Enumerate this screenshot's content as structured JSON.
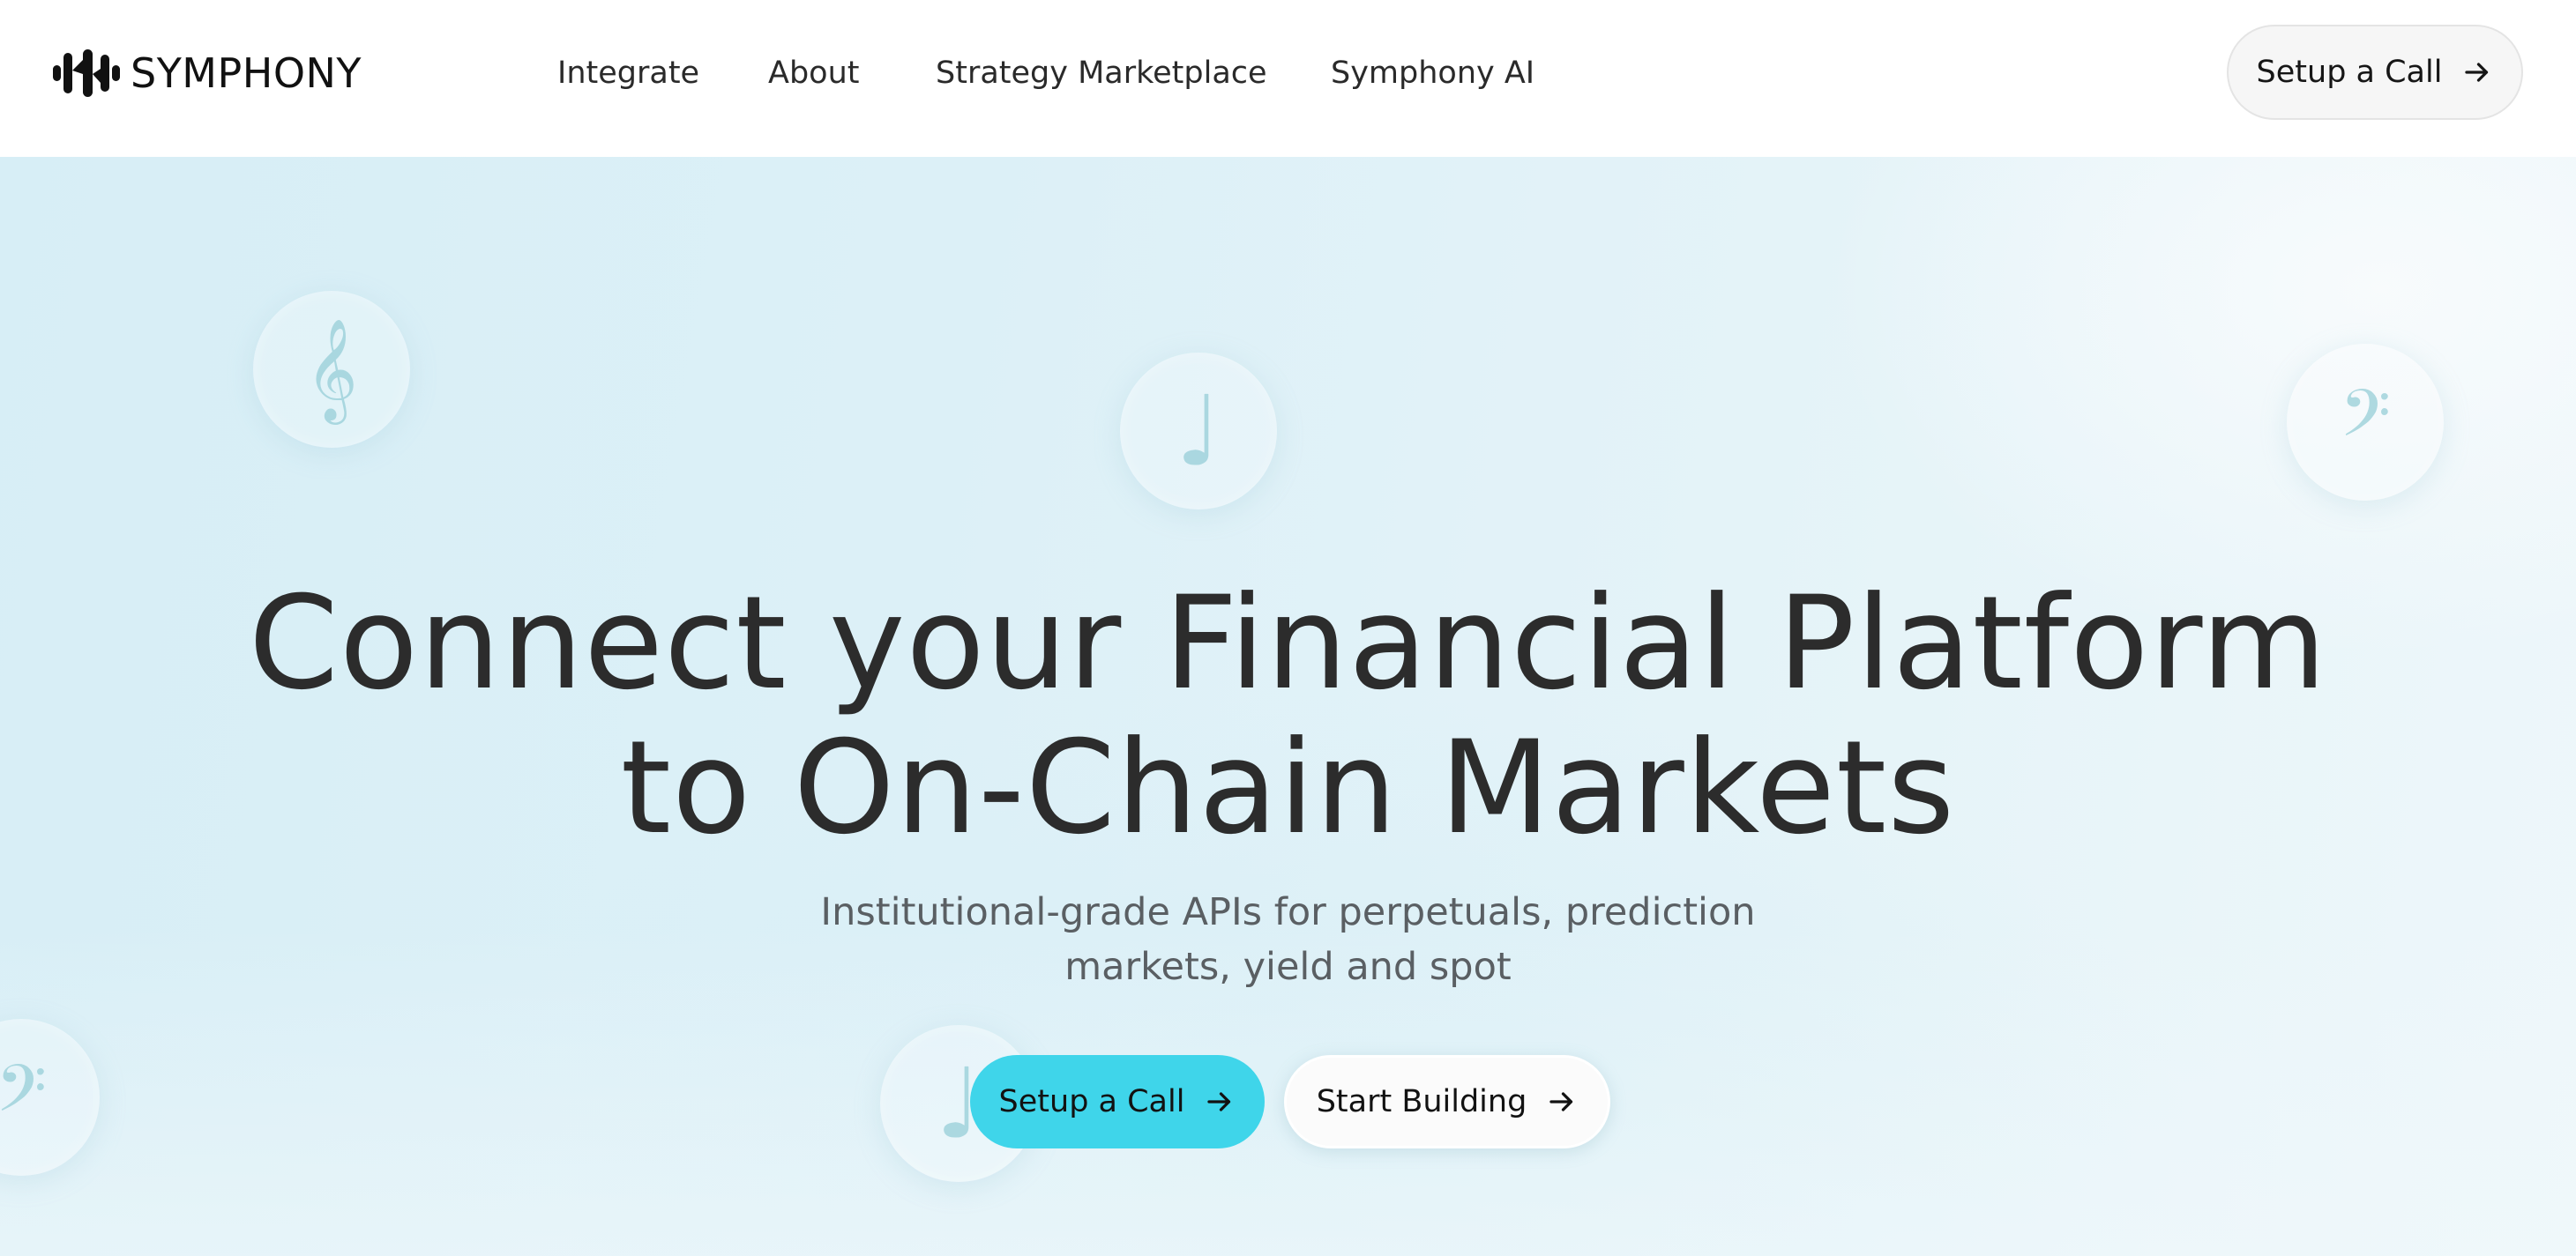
{
  "brand": {
    "name": "SYMPHONY",
    "logo_icon": "waveform-logo-icon"
  },
  "nav": {
    "items": [
      {
        "label": "Integrate"
      },
      {
        "label": "About"
      },
      {
        "label": "Strategy Marketplace"
      },
      {
        "label": "Symphony AI"
      }
    ],
    "cta_label": "Setup a Call",
    "cta_icon": "arrow-right-icon"
  },
  "hero": {
    "headline_line1": "Connect your Financial Platform",
    "headline_line2": "to On-Chain Markets",
    "subtitle_line1": "Institutional-grade APIs for perpetuals, prediction",
    "subtitle_line2": "markets, yield and spot",
    "primary_button": "Setup a Call",
    "secondary_button": "Start Building",
    "button_icon": "arrow-right-icon",
    "decorations": [
      {
        "glyph": "𝄞",
        "icon": "treble-clef-icon"
      },
      {
        "glyph": "♩",
        "icon": "quarter-note-icon"
      },
      {
        "glyph": "𝄢",
        "icon": "bass-clef-icon"
      },
      {
        "glyph": "𝄢",
        "icon": "bass-clef-icon"
      },
      {
        "glyph": "♩",
        "icon": "quarter-note-icon"
      }
    ]
  },
  "colors": {
    "accent": "#3fd5ea",
    "text_dark": "#2c2c2c",
    "hero_bg": "#dcf0f7"
  }
}
